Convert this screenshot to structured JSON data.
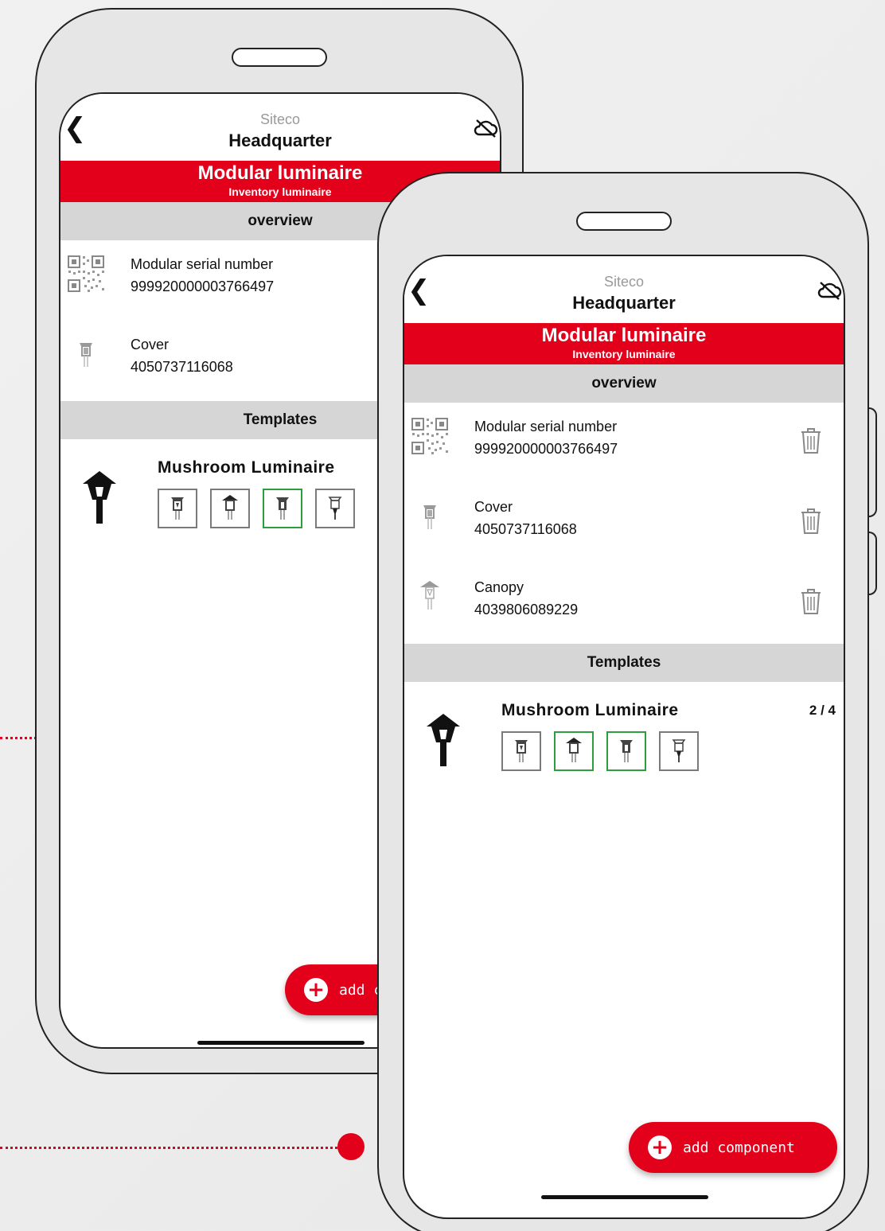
{
  "back_screen": {
    "brand": "Siteco",
    "site": "Headquarter",
    "title": "Modular luminaire",
    "subtitle": "Inventory luminaire",
    "overview_label": "overview",
    "items": [
      {
        "label": "Modular serial number",
        "value": "999920000003766497",
        "icon": "qr-code-icon"
      },
      {
        "label": "Cover",
        "value": "4050737116068",
        "icon": "cover-component-icon"
      }
    ],
    "templates_label": "Templates",
    "template": {
      "name": "Mushroom Luminaire"
    },
    "fab_label": "add c"
  },
  "front_screen": {
    "brand": "Siteco",
    "site": "Headquarter",
    "title": "Modular luminaire",
    "subtitle": "Inventory luminaire",
    "overview_label": "overview",
    "items": [
      {
        "label": "Modular serial number",
        "value": "999920000003766497",
        "icon": "qr-code-icon"
      },
      {
        "label": "Cover",
        "value": "4050737116068",
        "icon": "cover-component-icon"
      },
      {
        "label": "Canopy",
        "value": "4039806089229",
        "icon": "canopy-component-icon"
      }
    ],
    "templates_label": "Templates",
    "template": {
      "name": "Mushroom Luminaire",
      "count": "2 / 4"
    },
    "fab_label": "add component"
  },
  "colors": {
    "accent_red": "#e2001a",
    "selected_green": "#2e9d3c",
    "section_gray": "#d6d6d6"
  }
}
